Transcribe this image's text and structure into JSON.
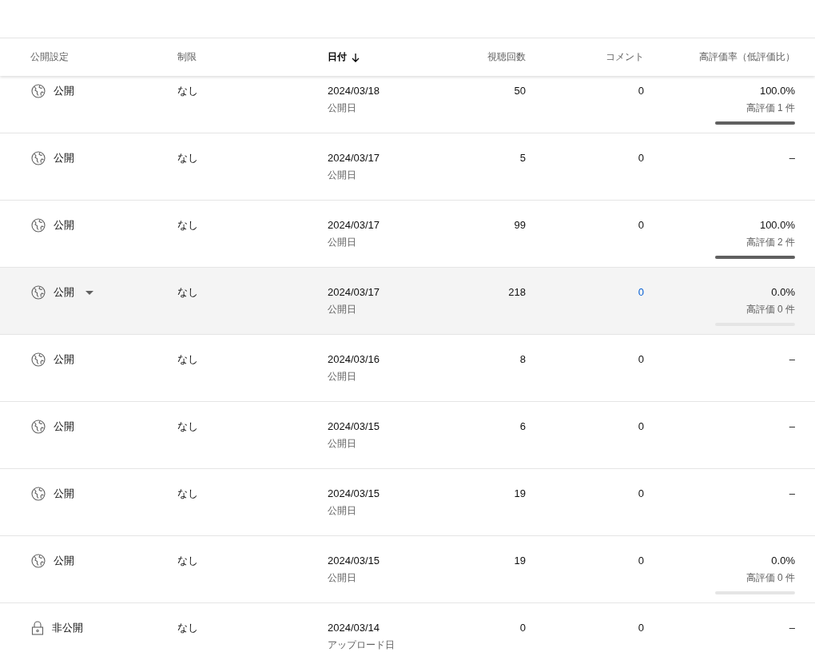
{
  "table": {
    "columns": [
      {
        "label": "公開設定",
        "sorted": false
      },
      {
        "label": "制限",
        "sorted": false
      },
      {
        "label": "日付",
        "sorted": true
      },
      {
        "label": "視聴回数",
        "sorted": false
      },
      {
        "label": "コメント",
        "sorted": false
      },
      {
        "label": "高評価率（低評価比）",
        "sorted": false
      }
    ],
    "rows": [
      {
        "visibility": {
          "kind": "public",
          "label": "公開"
        },
        "hovered": false,
        "restriction": "なし",
        "date": "2024/03/18",
        "date_type": "公開日",
        "views": "50",
        "comments": "0",
        "likes": {
          "ratio": "100.0%",
          "count": "高評価 1 件",
          "level": 1
        }
      },
      {
        "visibility": {
          "kind": "public",
          "label": "公開"
        },
        "hovered": false,
        "restriction": "なし",
        "date": "2024/03/17",
        "date_type": "公開日",
        "views": "5",
        "comments": "0",
        "likes": {
          "ratio": "–"
        }
      },
      {
        "visibility": {
          "kind": "public",
          "label": "公開"
        },
        "hovered": false,
        "restriction": "なし",
        "date": "2024/03/17",
        "date_type": "公開日",
        "views": "99",
        "comments": "0",
        "likes": {
          "ratio": "100.0%",
          "count": "高評価 2 件",
          "level": 1
        }
      },
      {
        "visibility": {
          "kind": "public",
          "label": "公開"
        },
        "hovered": true,
        "restriction": "なし",
        "date": "2024/03/17",
        "date_type": "公開日",
        "views": "218",
        "comments": "0",
        "likes": {
          "ratio": "0.0%",
          "count": "高評価 0 件",
          "level": 0
        }
      },
      {
        "visibility": {
          "kind": "public",
          "label": "公開"
        },
        "hovered": false,
        "restriction": "なし",
        "date": "2024/03/16",
        "date_type": "公開日",
        "views": "8",
        "comments": "0",
        "likes": {
          "ratio": "–"
        }
      },
      {
        "visibility": {
          "kind": "public",
          "label": "公開"
        },
        "hovered": false,
        "restriction": "なし",
        "date": "2024/03/15",
        "date_type": "公開日",
        "views": "6",
        "comments": "0",
        "likes": {
          "ratio": "–"
        }
      },
      {
        "visibility": {
          "kind": "public",
          "label": "公開"
        },
        "hovered": false,
        "restriction": "なし",
        "date": "2024/03/15",
        "date_type": "公開日",
        "views": "19",
        "comments": "0",
        "likes": {
          "ratio": "–"
        }
      },
      {
        "visibility": {
          "kind": "public",
          "label": "公開"
        },
        "hovered": false,
        "restriction": "なし",
        "date": "2024/03/15",
        "date_type": "公開日",
        "views": "19",
        "comments": "0",
        "likes": {
          "ratio": "0.0%",
          "count": "高評価 0 件",
          "level": 0
        }
      },
      {
        "visibility": {
          "kind": "private",
          "label": "非公開"
        },
        "hovered": false,
        "restriction": "なし",
        "date": "2024/03/14",
        "date_type": "アップロード日",
        "views": "0",
        "comments": "0",
        "likes": {
          "ratio": "–"
        }
      }
    ]
  }
}
